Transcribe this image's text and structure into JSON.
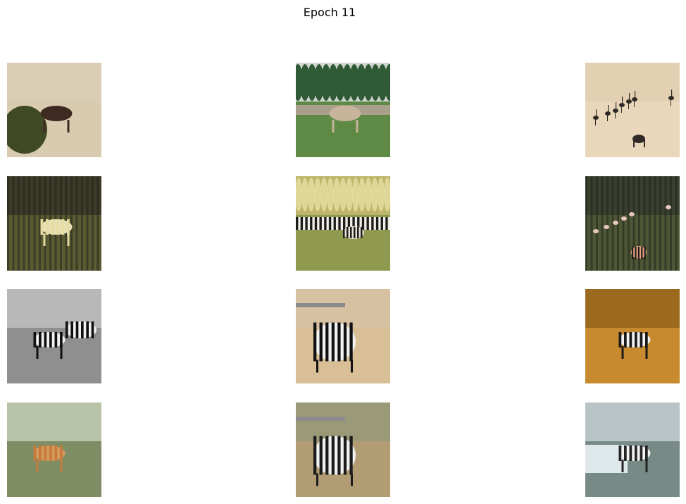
{
  "figure": {
    "title": "Epoch 11"
  },
  "images": [
    {
      "name": "dark-horse-on-dry-grass",
      "palette": {
        "sky": "#d9cdb4",
        "ground": "#d8cbb0",
        "accent": "#3f2a22"
      }
    },
    {
      "name": "pale-horse-and-herd-before-forest",
      "palette": {
        "sky": "#cfd6cf",
        "ground": "#5f8a45",
        "accent": "#c7b49a"
      }
    },
    {
      "name": "horse-and-ostriches-on-sand",
      "palette": {
        "sky": "#e3cfb2",
        "ground": "#e9d6bb",
        "accent": "#2f2a26"
      }
    },
    {
      "name": "translated-zebra-dark-grass",
      "palette": {
        "sky": "#3d3a28",
        "ground": "#5a5a33",
        "accent": "#e6dca3"
      }
    },
    {
      "name": "translated-zebra-herd-stylized",
      "palette": {
        "sky": "#bdb56a",
        "ground": "#8f9950",
        "accent": "#2b2b2b"
      }
    },
    {
      "name": "translated-zebra-ostriches",
      "palette": {
        "sky": "#3a4030",
        "ground": "#4d5735",
        "accent": "#e6c6bd"
      }
    },
    {
      "name": "grayscale-zebras-grazing",
      "palette": {
        "sky": "#b8b8b8",
        "ground": "#8f8f8f",
        "accent": "#111111"
      }
    },
    {
      "name": "zebra-closeup-standing",
      "palette": {
        "sky": "#d6c2a3",
        "ground": "#d8bf95",
        "accent": "#111111"
      }
    },
    {
      "name": "zebra-foal-golden-grass",
      "palette": {
        "sky": "#9b6a1e",
        "ground": "#c78a2e",
        "accent": "#1a1a1a"
      }
    },
    {
      "name": "reconstructed-horses-grazing",
      "palette": {
        "sky": "#b8c3a8",
        "ground": "#7e8d64",
        "accent": "#c77b3a"
      }
    },
    {
      "name": "reconstructed-zebra-closeup",
      "palette": {
        "sky": "#9b9a78",
        "ground": "#b29c74",
        "accent": "#1b1b1b"
      }
    },
    {
      "name": "reconstructed-zebra-foal-water",
      "palette": {
        "sky": "#b9c4c7",
        "ground": "#778a86",
        "accent": "#252525"
      }
    }
  ]
}
